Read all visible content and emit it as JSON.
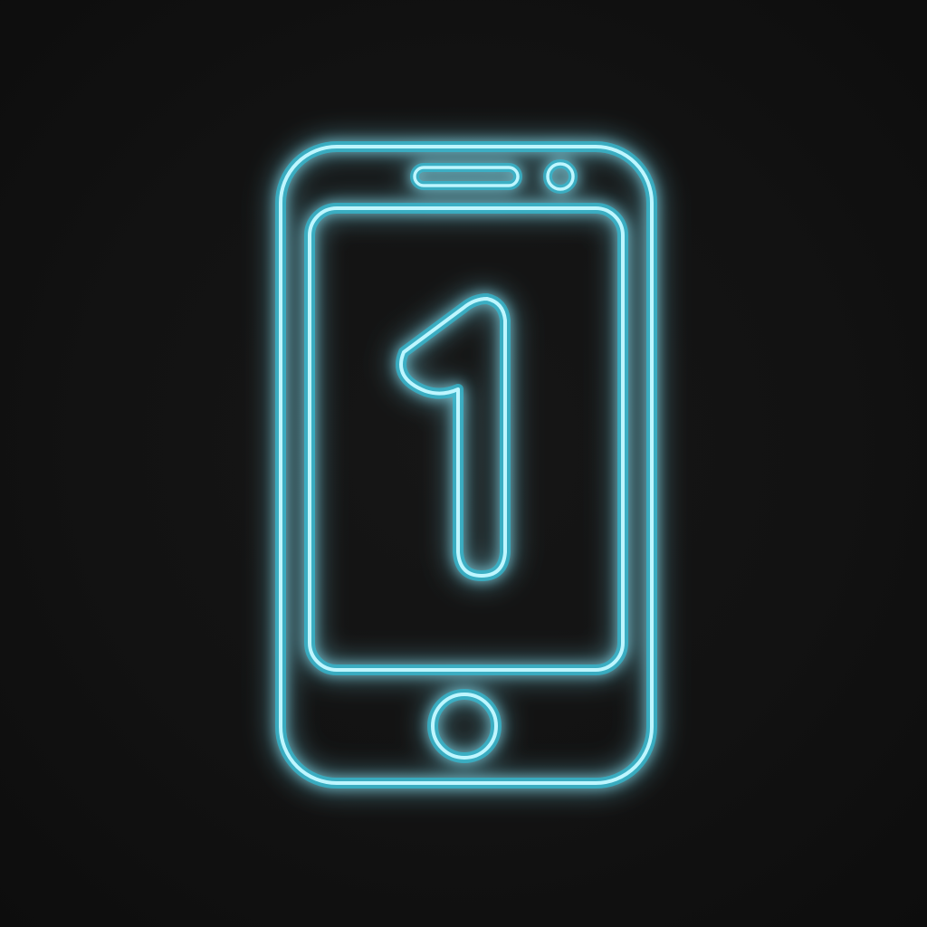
{
  "scene": {
    "subject_icon": "smartphone-icon",
    "screen_content": {
      "icon": "number-one-icon",
      "text": "1"
    },
    "colors": {
      "background": "#121212",
      "neon_glow": "#1fb8d0",
      "neon_core": "#bff6ff"
    }
  }
}
